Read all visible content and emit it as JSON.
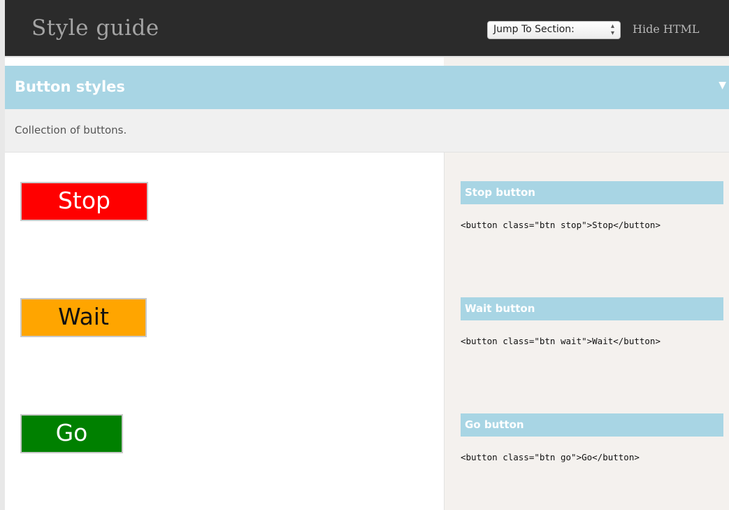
{
  "header": {
    "title": "Style guide",
    "jump_label": "Jump To Section:",
    "jump_arrows": "⌃⌄",
    "hide_html": "Hide HTML"
  },
  "section": {
    "title": "Button styles",
    "toggle": "▼",
    "description": "Collection of buttons."
  },
  "examples": [
    {
      "button_label": "Stop",
      "title": "Stop button",
      "code": "<button class=\"btn stop\">Stop</button>",
      "color": "#ff0000"
    },
    {
      "button_label": "Wait",
      "title": "Wait button",
      "code": "<button class=\"btn wait\">Wait</button>",
      "color": "#ffa500"
    },
    {
      "button_label": "Go",
      "title": "Go button",
      "code": "<button class=\"btn go\">Go</button>",
      "color": "#008000"
    }
  ],
  "colors": {
    "header_bg": "#2b2b2b",
    "accent": "#a8d5e4",
    "code_bg": "#f4f1ee"
  }
}
